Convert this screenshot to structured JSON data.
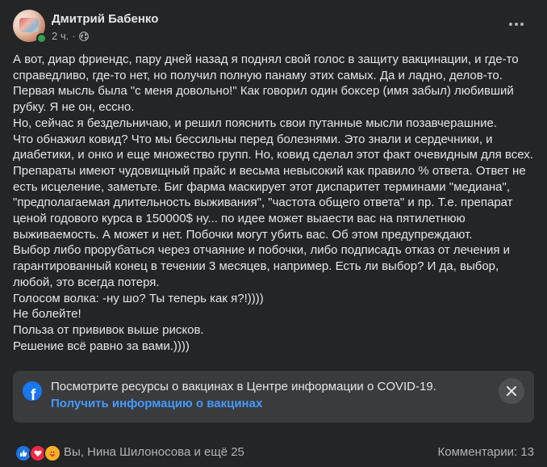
{
  "post": {
    "author": "Дмитрий Бабенко",
    "time": "2 ч.",
    "separator": "·",
    "privacy_icon": "globe-icon",
    "text_lines": [
      "А вот, диар фриендс, пару дней назад я поднял свой голос в защиту вакцинации, и где-то",
      "справедливо, где-то нет, но получил полную панаму этих самых. Да и ладно, делов-то.",
      "Первая мысль была \"с меня довольно!\" Как говорил один боксер (имя забыл)  любивший",
      "рубку. Я не он, ессно.",
      "Но, сейчас я бездельничаю, и решил пояснить свои путанные мысли позавчерашние.",
      "Что обнажил ковид? Что мы бессильны перед болезнями. Это знали и сердечники, и",
      "диабетики, и онко и еще множество групп. Но, ковид сделал этот факт очевидным для всех.",
      "Препараты имеют чудовищный прайс и весьма невысокий как правило % ответа. Ответ не",
      "есть исцеление, заметьте. Биг фарма маскирует этот диспаритет терминами  \"медиана\",",
      "\"предполагаемая длительность выживания\", \"частота общего ответа\" и пр. Т.е. препарат",
      "ценой годового курса в 150000$ ну... по идее может выаести вас на пятилетнюю",
      "выживаемость. А может и нет. Побочки могут убить вас. Об этом предупреждают.",
      "Выбор либо прорубаться через отчаяние и побочки, либо подписадъ отказ от лечения и",
      "гарантированный конец в течении 3 месяцев, например. Есть ли выбор? И да, выбор,",
      "любой, это всегда потеря.",
      "Голосом волка: -ну шо? Ты теперь как я?!))))",
      "Не болейте!",
      "Польза от прививок выше рисков.",
      "Решение всё равно за вами.))))"
    ]
  },
  "covid_info": {
    "icon": "facebook-icon",
    "text": "Посмотрите ресурсы о вакцинах в Центре информации о COVID-19.",
    "link": "Получить информацию о вакцинах",
    "close_icon": "close-icon"
  },
  "footer": {
    "reaction_icons": [
      "like-icon",
      "love-icon",
      "care-icon"
    ],
    "reactions_text": "Вы, Нина Шилоносова и ещё 25",
    "comments_text": "Комментарии: 13"
  },
  "colors": {
    "background": "#242526",
    "text": "#e4e6eb",
    "secondary": "#b0b3b8",
    "link": "#4599ff",
    "brand": "#1877f2"
  }
}
